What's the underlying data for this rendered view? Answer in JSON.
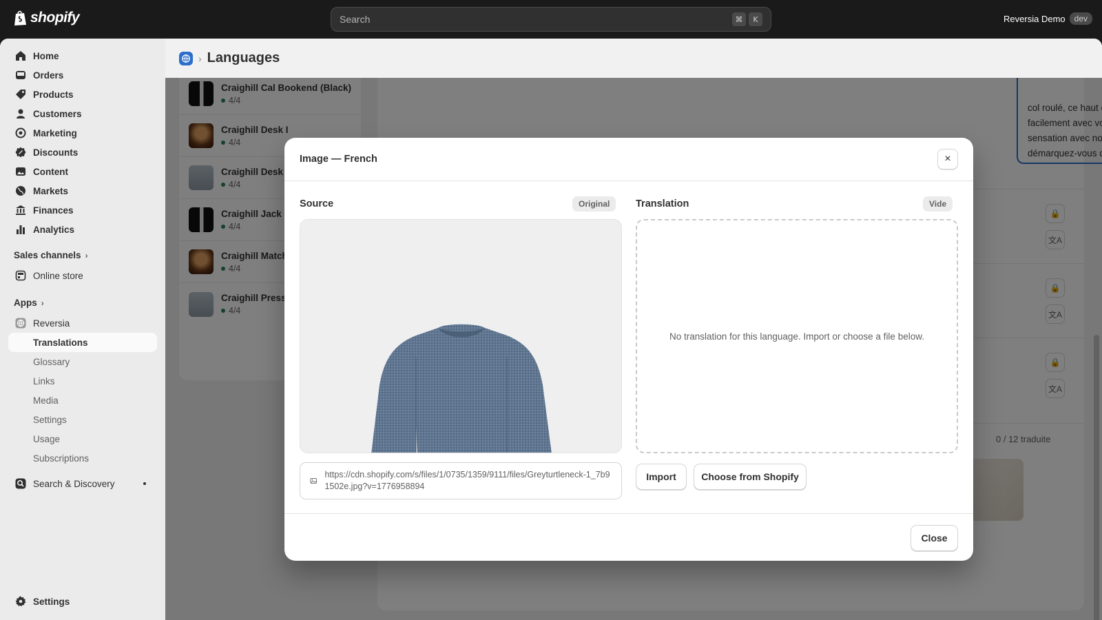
{
  "topbar": {
    "brand": "shopify",
    "search_placeholder": "Search",
    "shortcut_cmd": "⌘",
    "shortcut_key": "K",
    "store_name": "Reversia Demo",
    "store_badge": "dev"
  },
  "sidebar": {
    "items": [
      {
        "label": "Home",
        "icon": "home-icon"
      },
      {
        "label": "Orders",
        "icon": "orders-icon"
      },
      {
        "label": "Products",
        "icon": "tag-icon"
      },
      {
        "label": "Customers",
        "icon": "person-icon"
      },
      {
        "label": "Marketing",
        "icon": "target-icon"
      },
      {
        "label": "Discounts",
        "icon": "discount-icon"
      },
      {
        "label": "Content",
        "icon": "content-icon"
      },
      {
        "label": "Markets",
        "icon": "globe-icon"
      },
      {
        "label": "Finances",
        "icon": "bank-icon"
      },
      {
        "label": "Analytics",
        "icon": "chart-icon"
      }
    ],
    "sales_channels": "Sales channels",
    "online_store": "Online store",
    "apps": "Apps",
    "app_name": "Reversia",
    "app_subitems": [
      "Translations",
      "Glossary",
      "Links",
      "Media",
      "Settings",
      "Usage",
      "Subscriptions"
    ],
    "search_discovery": "Search & Discovery",
    "settings": "Settings"
  },
  "page": {
    "title": "Languages"
  },
  "product_list": [
    {
      "title": "Craighill Cal Bookend (Black)",
      "count": "4/4",
      "thumb": "dark"
    },
    {
      "title": "Craighill Desk I",
      "count": "4/4",
      "thumb": "orange"
    },
    {
      "title": "Craighill Desk I",
      "count": "4/4",
      "thumb": "grey"
    },
    {
      "title": "Craighill Jack F",
      "count": "4/4",
      "thumb": "dark"
    },
    {
      "title": "Craighill Match",
      "count": "4/4",
      "thumb": "orange"
    },
    {
      "title": "Craighill Press",
      "count": "4/4",
      "thumb": "grey"
    }
  ],
  "background": {
    "description_text": "col roulé, ce haut est parfaitement à se marie facilement avec vos bas préférés. Faites sensation avec notre col roulé marron et démarquez-vous de la foule !",
    "count": "0 / 12 traduite"
  },
  "modal": {
    "title": "Image — French",
    "source_label": "Source",
    "source_badge": "Original",
    "translation_label": "Translation",
    "translation_badge": "Vide",
    "empty_message": "No translation for this language. Import or choose a file below.",
    "image_url": "https://cdn.shopify.com/s/files/1/0735/1359/9111/files/Greyturtleneck-1_7b91502e.jpg?v=1776958894",
    "import_button": "Import",
    "choose_button": "Choose from Shopify",
    "close_button": "Close",
    "close_icon": "×"
  },
  "colors": {
    "accent": "#2c6ecb",
    "topbar": "#1a1a1a",
    "status_green": "#29845a"
  }
}
